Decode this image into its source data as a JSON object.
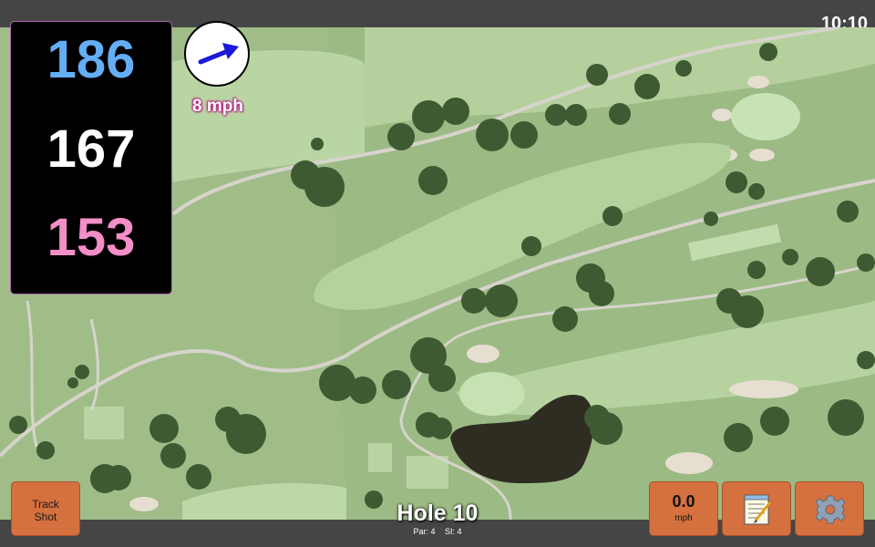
{
  "status_bar": {
    "time": "10:10"
  },
  "distances": {
    "back": "186",
    "middle": "167",
    "front": "153"
  },
  "wind": {
    "speed_label": "8 mph",
    "icon": "arrow-right-icon"
  },
  "hole": {
    "title": "Hole 10",
    "par": "Par: 4",
    "si": "SI: 4"
  },
  "buttons": {
    "track_shot_line1": "Track",
    "track_shot_line2": "Shot",
    "speed_value": "0.0",
    "speed_unit": "mph",
    "notes_icon": "notepad-icon",
    "settings_icon": "gear-icon"
  },
  "colors": {
    "back_distance": "#64aef5",
    "middle_distance": "#ffffff",
    "front_distance": "#f48ec6",
    "button_orange": "#d5703f",
    "wind_text_glow": "#b3247f"
  }
}
